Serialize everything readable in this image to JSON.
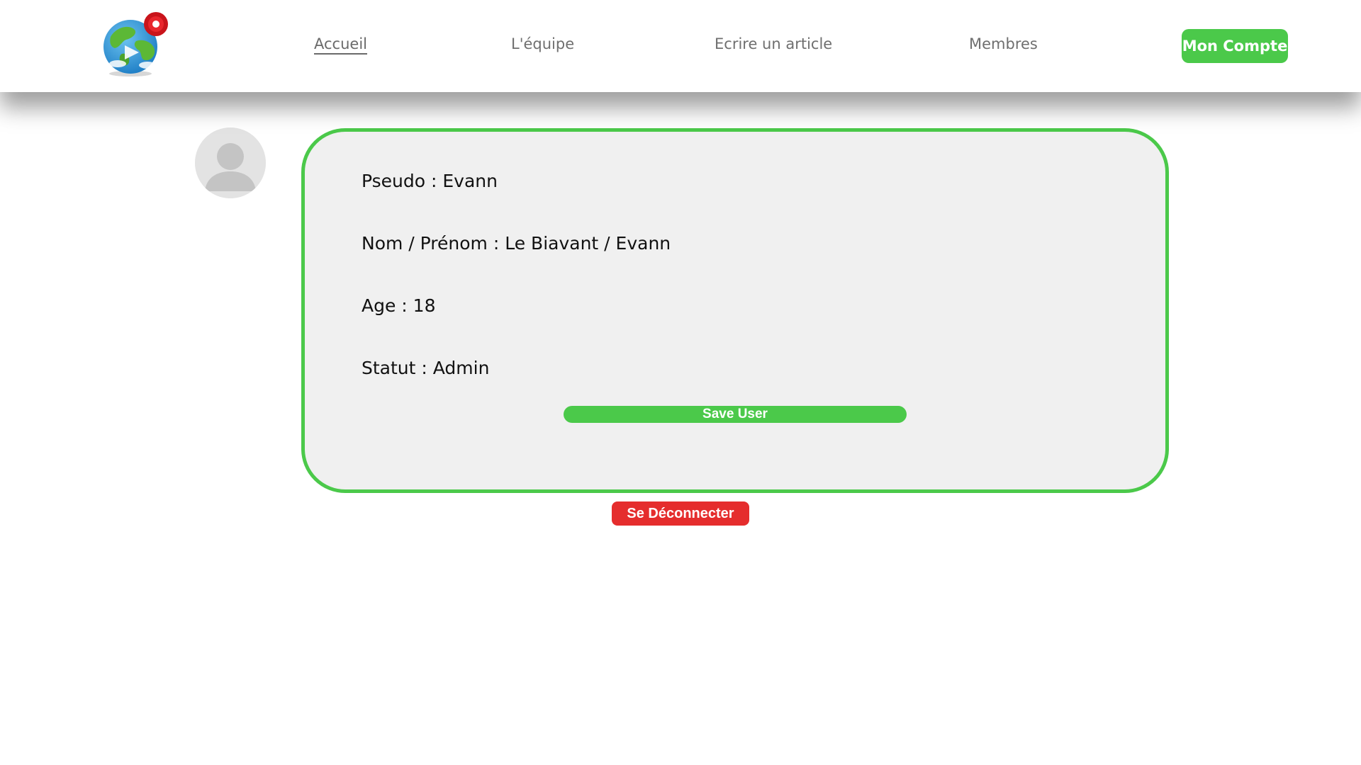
{
  "header": {
    "logo_icon": "globe-with-location-pin-icon",
    "nav": [
      {
        "label": "Accueil",
        "active": true
      },
      {
        "label": "L'équipe",
        "active": false
      },
      {
        "label": "Ecrire un article",
        "active": false
      },
      {
        "label": "Membres",
        "active": false
      }
    ],
    "account_label": "Mon Compte"
  },
  "profile": {
    "avatar_icon": "user-avatar-icon",
    "fields": [
      {
        "key": "pseudo",
        "text": "Pseudo : Evann"
      },
      {
        "key": "name",
        "text": "Nom / Prénom : Le Biavant / Evann"
      },
      {
        "key": "age",
        "text": "Age : 18"
      },
      {
        "key": "status",
        "text": "Statut : Admin"
      }
    ],
    "save_label": "Save User"
  },
  "logout_label": "Se Déconnecter",
  "colors": {
    "accent_green": "#4bc94a",
    "danger_red": "#e52d2d",
    "card_bg": "#f0f0f0",
    "nav_text": "#6f6f6f"
  }
}
